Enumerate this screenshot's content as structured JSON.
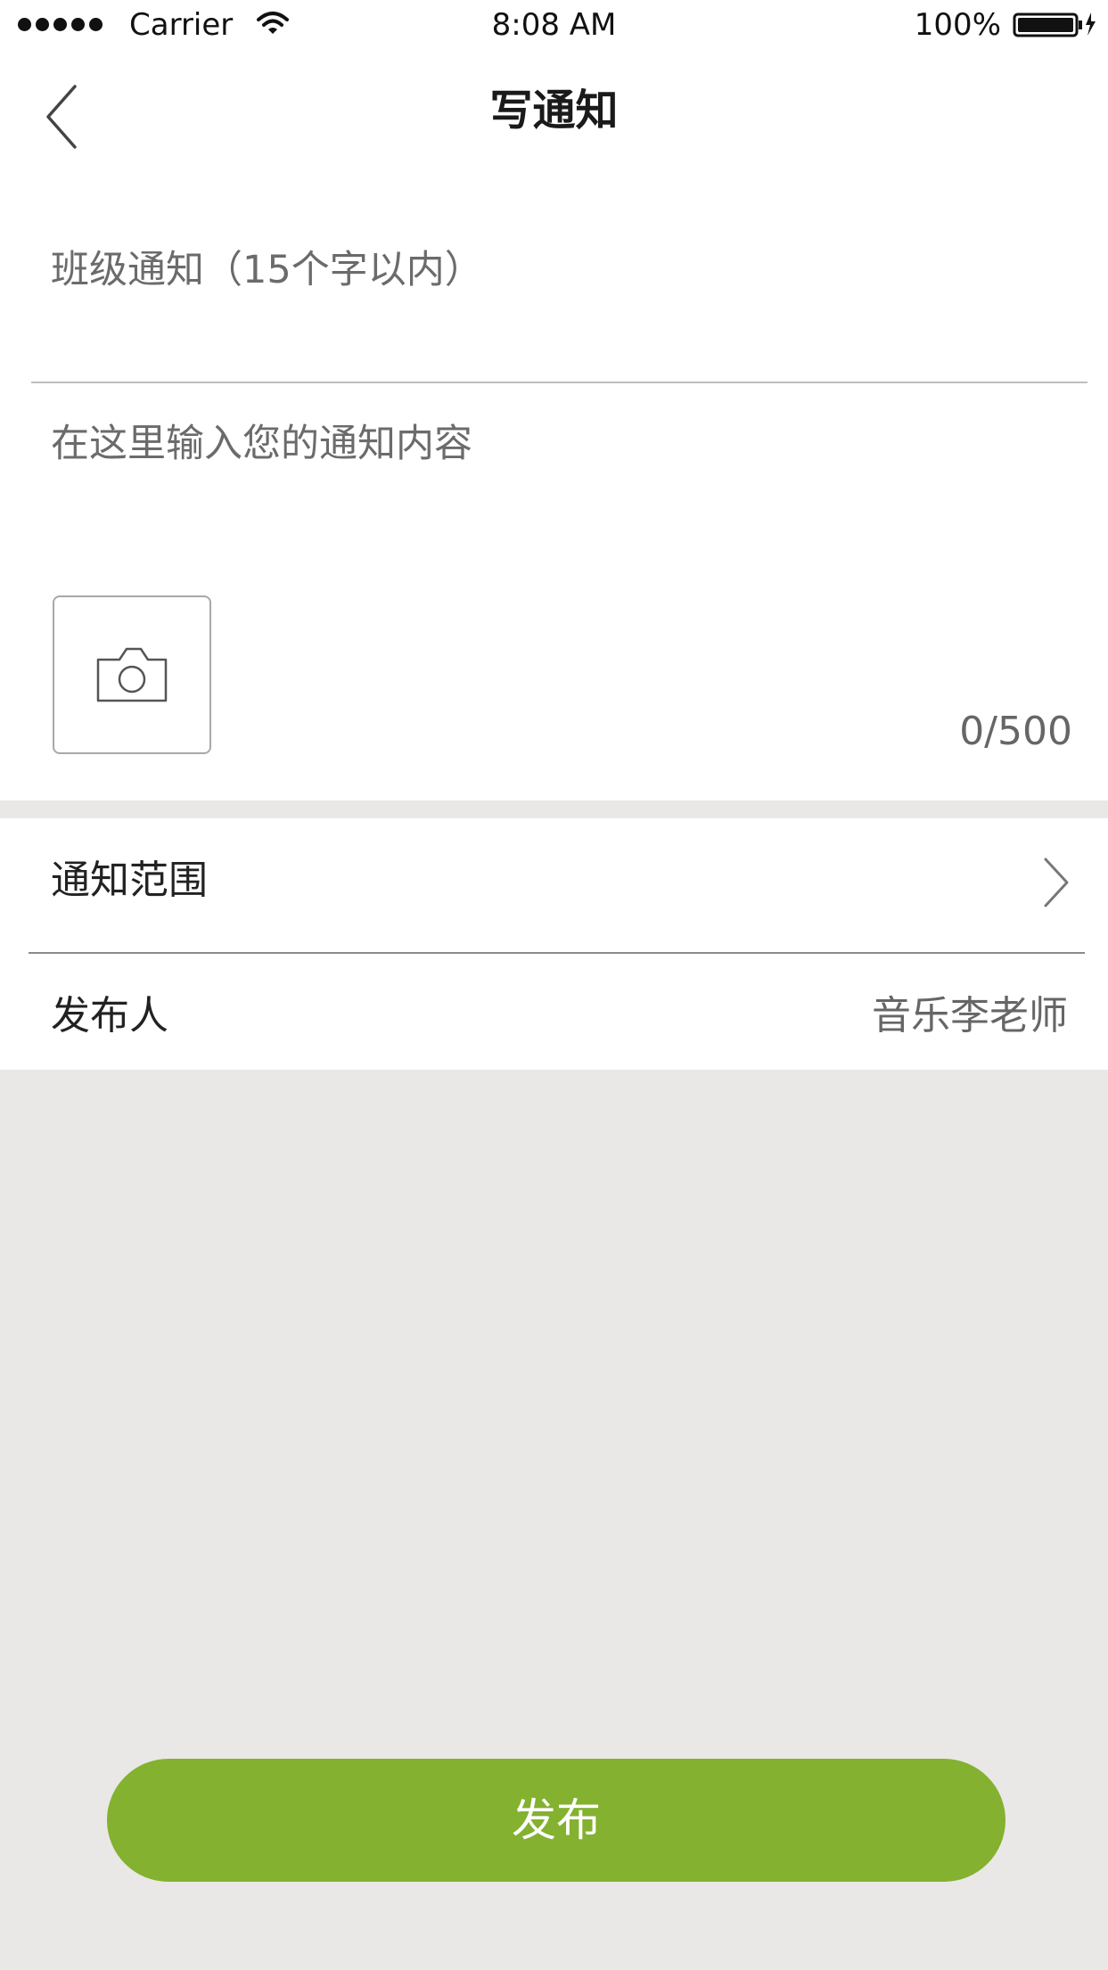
{
  "status_bar": {
    "carrier": "Carrier",
    "time": "8:08 AM",
    "battery": "100%"
  },
  "nav": {
    "title": "写通知",
    "back_icon": "chevron-left-icon"
  },
  "compose": {
    "title_placeholder": "班级通知（15个字以内）",
    "title_value": "",
    "content_placeholder": "在这里输入您的通知内容",
    "content_value": "",
    "photo_icon": "camera-icon",
    "counter": "0/500"
  },
  "settings": {
    "scope_label": "通知范围",
    "scope_icon": "chevron-right-icon",
    "publisher_label": "发布人",
    "publisher_value": "音乐李老师"
  },
  "actions": {
    "publish_label": "发布"
  },
  "colors": {
    "accent": "#84b12f",
    "background": "#e9e8e6",
    "surface": "#ffffff"
  }
}
